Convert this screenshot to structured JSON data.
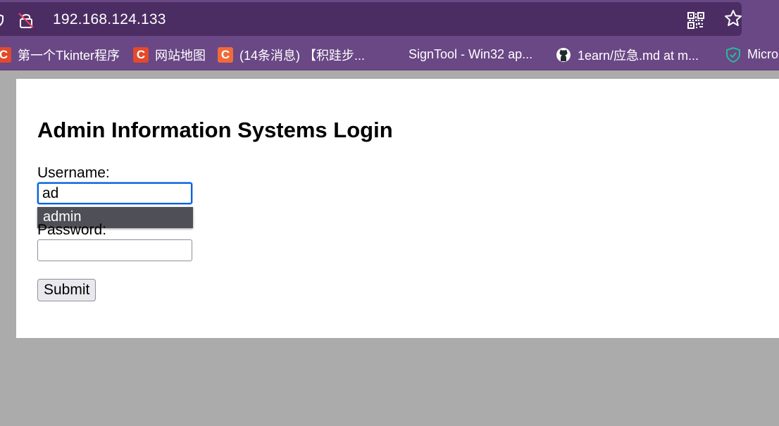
{
  "browser": {
    "url": "192.168.124.133",
    "bookmarks": [
      {
        "label": "第一个Tkinter程序",
        "icon": "csdn-icon"
      },
      {
        "label": "网站地图",
        "icon": "csdn-icon"
      },
      {
        "label": "(14条消息) 【积跬步...",
        "icon": "csdn-icon"
      },
      {
        "label": "SignTool - Win32 ap...",
        "icon": "microsoft-icon"
      },
      {
        "label": "1earn/应急.md at m...",
        "icon": "github-icon"
      },
      {
        "label": "Micro",
        "icon": "shield-check-icon"
      }
    ],
    "theme_color": "#6a4785"
  },
  "form": {
    "title": "Admin Information Systems Login",
    "username_label": "Username:",
    "username_value": "ad",
    "autocomplete_suggestion": "admin",
    "password_label": "Password:",
    "password_value": "",
    "submit_label": "Submit"
  }
}
